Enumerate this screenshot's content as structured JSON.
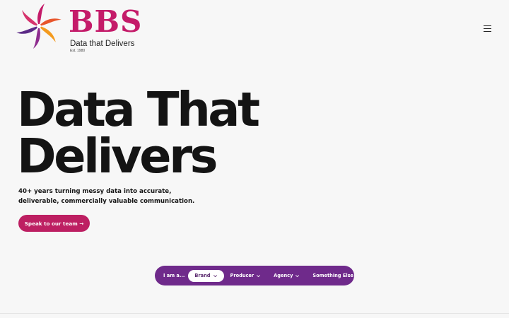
{
  "header": {
    "logo": {
      "wordmark": "BBS",
      "tagline": "Data that Delivers",
      "established": "Est. 1980",
      "brand_color": "#c41b69",
      "icon": "swirl-logo-icon"
    },
    "menu_icon": "hamburger-menu-icon"
  },
  "hero": {
    "title_line1": "Data That",
    "title_line2": "Delivers",
    "subtitle_line1": "40+ years turning messy data into accurate,",
    "subtitle_line2": "deliverable, commercially valuable communication.",
    "cta_label": "Speak to our team →",
    "cta_color": "#bd1f62"
  },
  "audience_selector": {
    "lead": "I am a...",
    "bar_color": "#6f2a8b",
    "options": [
      {
        "label": "Brand",
        "selected": true
      },
      {
        "label": "Producer",
        "selected": false
      },
      {
        "label": "Agency",
        "selected": false
      },
      {
        "label": "Something Else",
        "selected": false
      }
    ]
  }
}
